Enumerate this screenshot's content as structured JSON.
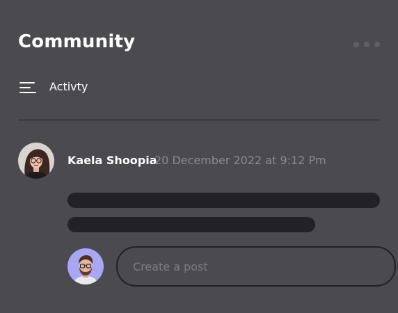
{
  "header": {
    "title": "Community",
    "more_icon": "more-horizontal-icon"
  },
  "filter": {
    "icon": "filter-lines-icon",
    "label": "Activty"
  },
  "post": {
    "author": {
      "name": "Kaela Shoopia",
      "avatar_icon": "user-avatar"
    },
    "timestamp": "20 December 2022 at 9:12 Pm"
  },
  "composer": {
    "avatar_icon": "current-user-avatar",
    "placeholder": "Create a post"
  },
  "colors": {
    "background": "#4a4a4f",
    "text_primary": "#ffffff",
    "text_muted": "#8a8a90",
    "skeleton": "#222226",
    "divider": "#1f1f22",
    "composer_avatar_bg": "#a9a6f4"
  }
}
